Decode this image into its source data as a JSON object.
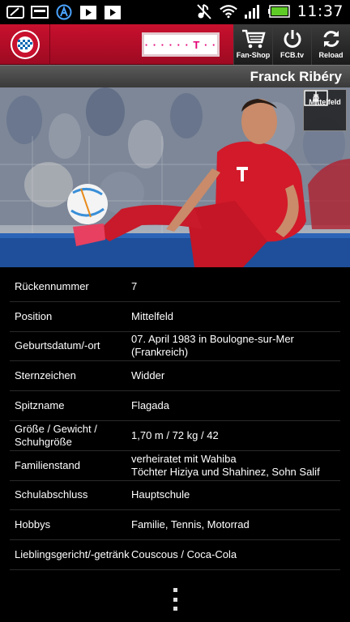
{
  "status_bar": {
    "time": "11:37",
    "icons": [
      "screen-mirror-icon",
      "image-icon",
      "assistant-icon",
      "play-store-icon",
      "play-store-icon",
      "mute-icon",
      "wifi-icon",
      "signal-icon",
      "battery-icon"
    ]
  },
  "header": {
    "club_logo": "FC Bayern München logo",
    "sponsor_text": "· · · · · · T · ·",
    "buttons": [
      {
        "label": "Fan-Shop",
        "icon": "cart-icon"
      },
      {
        "label": "FCB.tv",
        "icon": "power-icon"
      },
      {
        "label": "Reload",
        "icon": "reload-icon"
      }
    ]
  },
  "player": {
    "name": "Franck Ribéry",
    "position_badge": "Mittelfeld"
  },
  "details": [
    {
      "key": "Rückennummer",
      "value": "7"
    },
    {
      "key": "Position",
      "value": "Mittelfeld"
    },
    {
      "key": "Geburtsdatum/-ort",
      "value": "07. April 1983 in Boulogne-sur-Mer (Frankreich)"
    },
    {
      "key": "Sternzeichen",
      "value": "Widder"
    },
    {
      "key": "Spitzname",
      "value": "Flagada"
    },
    {
      "key": "Größe / Gewicht / Schuhgröße",
      "value": "1,70 m / 72 kg / 42"
    },
    {
      "key": "Familienstand",
      "value": "verheiratet mit Wahiba\nTöchter Hiziya und Shahinez, Sohn Salif"
    },
    {
      "key": "Schulabschluss",
      "value": "Hauptschule"
    },
    {
      "key": "Hobbys",
      "value": "Familie, Tennis, Motorrad"
    },
    {
      "key": "Lieblingsgericht/-getränk",
      "value": "Couscous / Coca-Cola"
    }
  ],
  "colors": {
    "brand_red": "#c8102e",
    "telekom_magenta": "#e20074"
  }
}
